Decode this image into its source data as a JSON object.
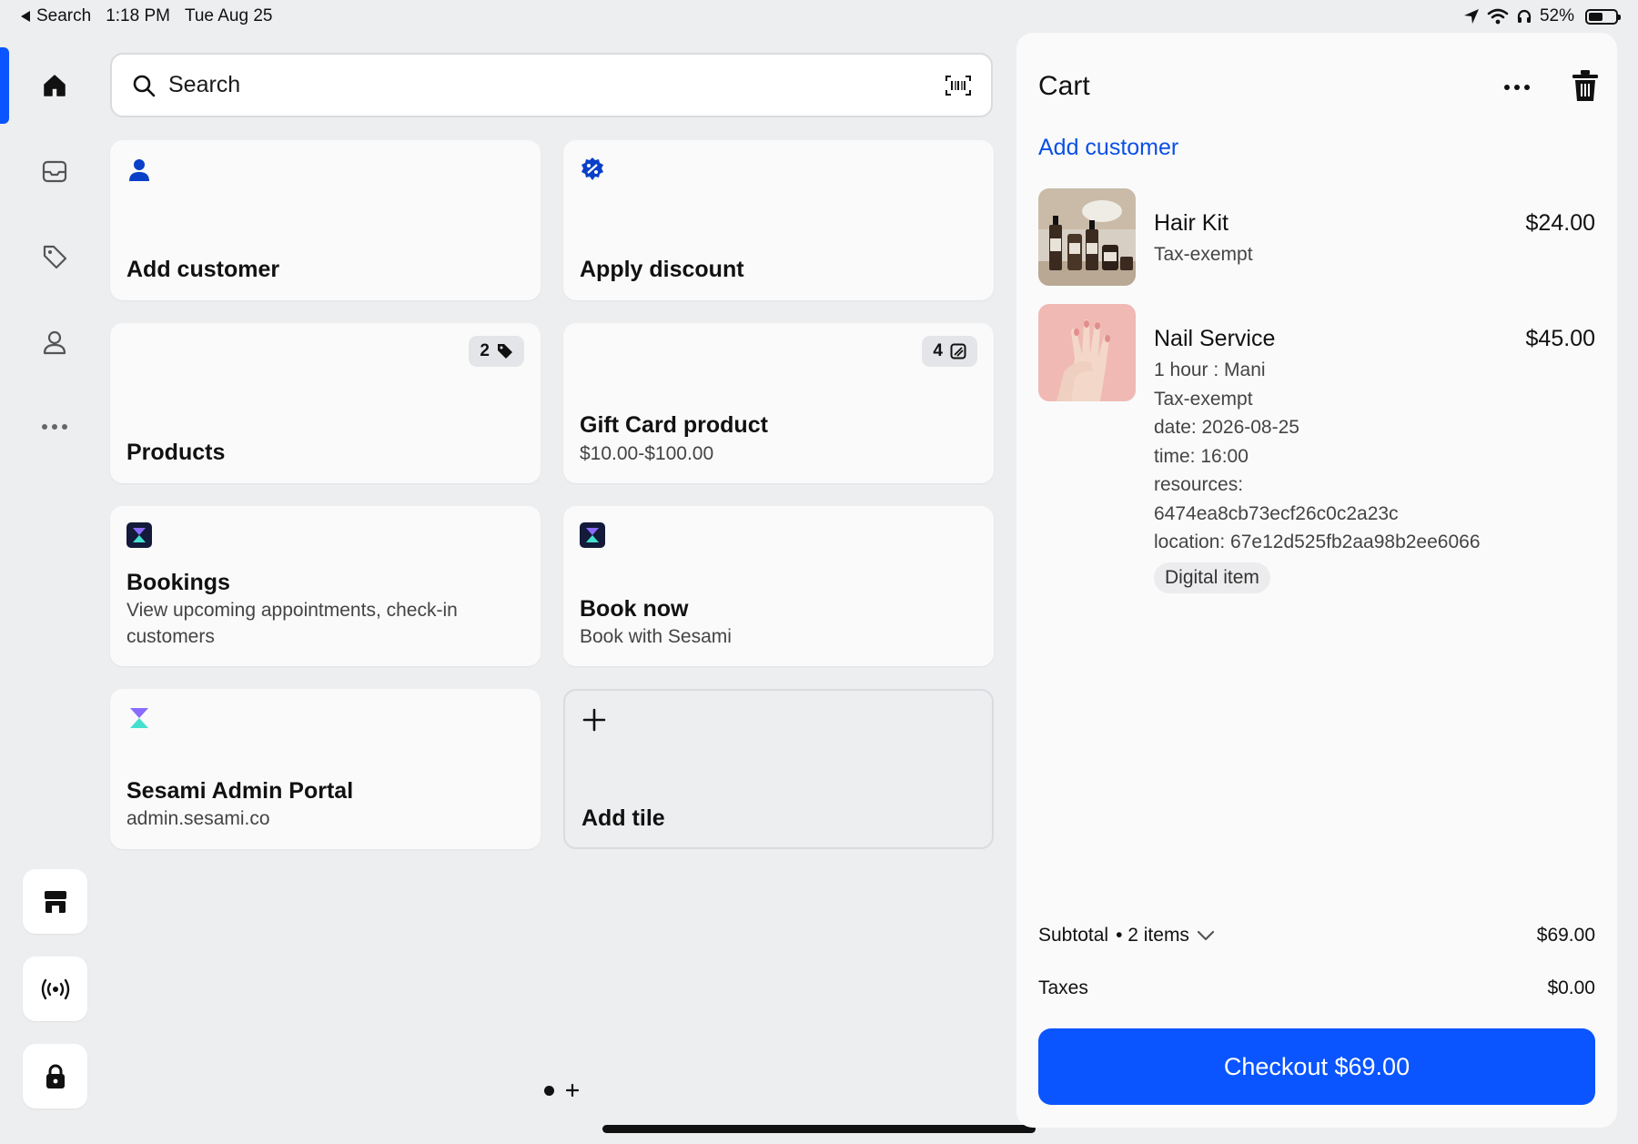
{
  "status_bar": {
    "back_label": "Search",
    "time": "1:18 PM",
    "date": "Tue Aug 25",
    "battery_percent": "52%",
    "battery_level": 0.52
  },
  "sidebar": {
    "items": [
      {
        "name": "home",
        "icon": "home-icon",
        "active": true
      },
      {
        "name": "orders",
        "icon": "inbox-icon",
        "active": false
      },
      {
        "name": "products",
        "icon": "tag-icon",
        "active": false
      },
      {
        "name": "customers",
        "icon": "person-icon",
        "active": false
      },
      {
        "name": "more",
        "icon": "more-icon",
        "active": false
      }
    ],
    "bottom_buttons": [
      {
        "name": "store",
        "icon": "store-icon"
      },
      {
        "name": "broadcast",
        "icon": "broadcast-icon"
      },
      {
        "name": "lock",
        "icon": "lock-icon"
      }
    ]
  },
  "search": {
    "placeholder": "Search",
    "scan_icon": "barcode-scan-icon"
  },
  "tiles": {
    "add_customer": {
      "title": "Add customer",
      "icon": "person-icon"
    },
    "apply_discount": {
      "title": "Apply discount",
      "icon": "discount-badge-icon"
    },
    "products": {
      "title": "Products",
      "badge_count": "2",
      "badge_icon": "tag-icon"
    },
    "gift_card": {
      "title": "Gift Card product",
      "subtitle": "$10.00-$100.00",
      "badge_count": "4",
      "badge_icon": "gift-card-icon"
    },
    "bookings": {
      "title": "Bookings",
      "subtitle": "View upcoming appointments, check-in customers",
      "icon": "sesami-icon"
    },
    "book_now": {
      "title": "Book now",
      "subtitle": "Book with Sesami",
      "icon": "sesami-icon"
    },
    "sesami_admin": {
      "title": "Sesami Admin Portal",
      "subtitle": "admin.sesami.co",
      "icon": "sesami-icon"
    },
    "add_tile": {
      "title": "Add tile",
      "icon": "plus-icon"
    }
  },
  "cart": {
    "title": "Cart",
    "add_customer": "Add customer",
    "items": [
      {
        "name": "Hair Kit",
        "price": "$24.00",
        "details": [
          "Tax-exempt"
        ]
      },
      {
        "name": "Nail Service",
        "price": "$45.00",
        "details": [
          "1 hour : Mani",
          "Tax-exempt",
          "date: 2026-08-25",
          "time: 16:00",
          "resources:",
          "6474ea8cb73ecf26c0c2a23c",
          "location: 67e12d525fb2aa98b2ee6066"
        ],
        "chip": "Digital item"
      }
    ],
    "subtotal_label": "Subtotal",
    "subtotal_items": "• 2 items",
    "subtotal_value": "$69.00",
    "taxes_label": "Taxes",
    "taxes_value": "$0.00",
    "checkout_label": "Checkout",
    "checkout_amount": "$69.00"
  },
  "colors": {
    "accent": "#0a55ff",
    "link": "#0a4fe6",
    "sesami_gradient_top": "#7b5cff",
    "sesami_gradient_bottom": "#3ee0d0"
  }
}
